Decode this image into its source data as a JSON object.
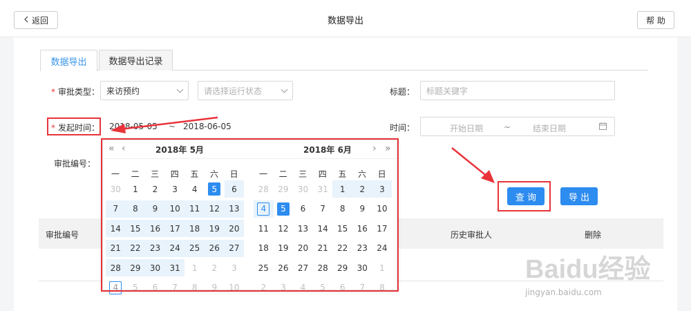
{
  "topbar": {
    "back_label": "返回",
    "title": "数据导出",
    "help_label": "帮 助"
  },
  "tabs": [
    {
      "label": "数据导出",
      "active": true
    },
    {
      "label": "数据导出记录",
      "active": false
    }
  ],
  "form": {
    "approval_type": {
      "label": "审批类型：",
      "value": "来访预约"
    },
    "run_status": {
      "placeholder": "请选择运行状态"
    },
    "title_field": {
      "label": "标题：",
      "placeholder": "标题关键字"
    },
    "start_time": {
      "label": "发起时间：",
      "start_value": "2018-05-05",
      "separator": "~",
      "end_value": "2018-06-05"
    },
    "time_field": {
      "label": "时间：",
      "start_placeholder": "开始日期",
      "separator": "~",
      "end_placeholder": "结束日期"
    },
    "approval_no": {
      "label": "审批编号："
    }
  },
  "buttons": {
    "query": "查 询",
    "export": "导 出"
  },
  "table": {
    "columns": [
      "审批编号",
      "历史审批人",
      "删除"
    ]
  },
  "datepicker": {
    "left_title": "2018年 5月",
    "right_title": "2018年 6月",
    "prev_year": "«",
    "prev_month": "‹",
    "next_month": "›",
    "next_year": "»",
    "weekdays": [
      "一",
      "二",
      "三",
      "四",
      "五",
      "六",
      "日"
    ],
    "left_days": [
      [
        "30",
        "1",
        "2",
        "3",
        "4",
        "5",
        "6"
      ],
      [
        "7",
        "8",
        "9",
        "10",
        "11",
        "12",
        "13"
      ],
      [
        "14",
        "15",
        "16",
        "17",
        "18",
        "19",
        "20"
      ],
      [
        "21",
        "22",
        "23",
        "24",
        "25",
        "26",
        "27"
      ],
      [
        "28",
        "29",
        "30",
        "31",
        "1",
        "2",
        "3"
      ],
      [
        "4",
        "5",
        "6",
        "7",
        "8",
        "9",
        "10"
      ]
    ],
    "right_days": [
      [
        "28",
        "29",
        "30",
        "31",
        "1",
        "2",
        "3"
      ],
      [
        "4",
        "5",
        "6",
        "7",
        "8",
        "9",
        "10"
      ],
      [
        "11",
        "12",
        "13",
        "14",
        "15",
        "16",
        "17"
      ],
      [
        "18",
        "19",
        "20",
        "21",
        "22",
        "23",
        "24"
      ],
      [
        "25",
        "26",
        "27",
        "28",
        "29",
        "30",
        "1"
      ],
      [
        "2",
        "3",
        "4",
        "5",
        "6",
        "7",
        "8"
      ]
    ]
  },
  "watermark": {
    "text": "Baidu经验",
    "sub": "jingyan.baidu.com"
  },
  "colors": {
    "accent": "#2d8cf0",
    "annotation": "#e8333a",
    "range_bg": "#e8f3fc"
  }
}
